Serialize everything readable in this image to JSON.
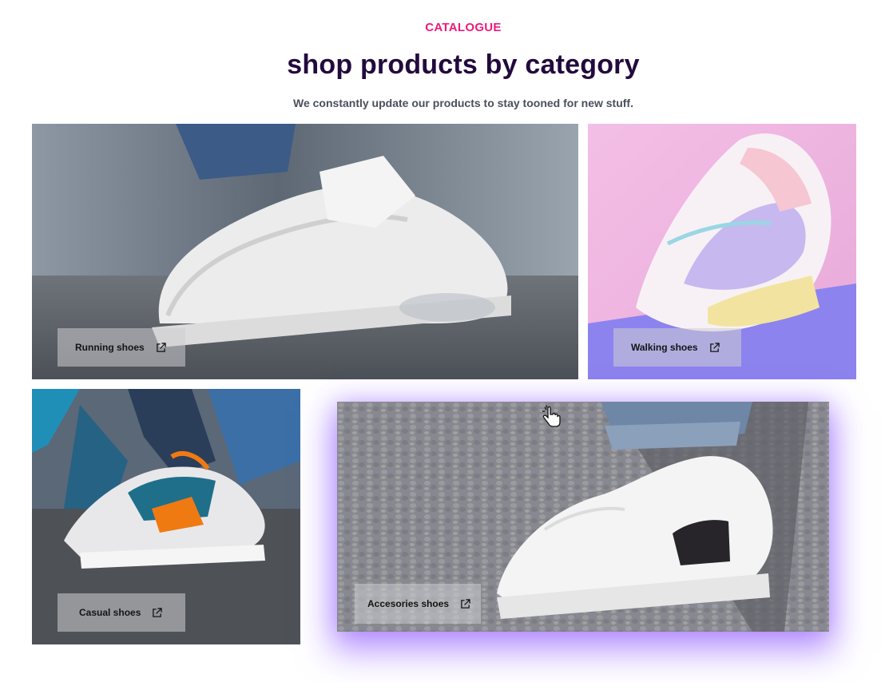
{
  "header": {
    "eyebrow": "CATALOGUE",
    "title": "shop products by category",
    "subtitle": "We constantly update our products to stay tooned for new stuff."
  },
  "categories": [
    {
      "label": "Running shoes",
      "icon": "external-link-icon"
    },
    {
      "label": "Walking shoes",
      "icon": "external-link-icon"
    },
    {
      "label": "Casual shoes",
      "icon": "external-link-icon"
    },
    {
      "label": "Accesories shoes",
      "icon": "external-link-icon"
    }
  ],
  "colors": {
    "eyebrow": "#ee1a7c",
    "title": "#230a3d",
    "subtitle": "#4a4f5c",
    "hover_glow": "#8246ff"
  }
}
